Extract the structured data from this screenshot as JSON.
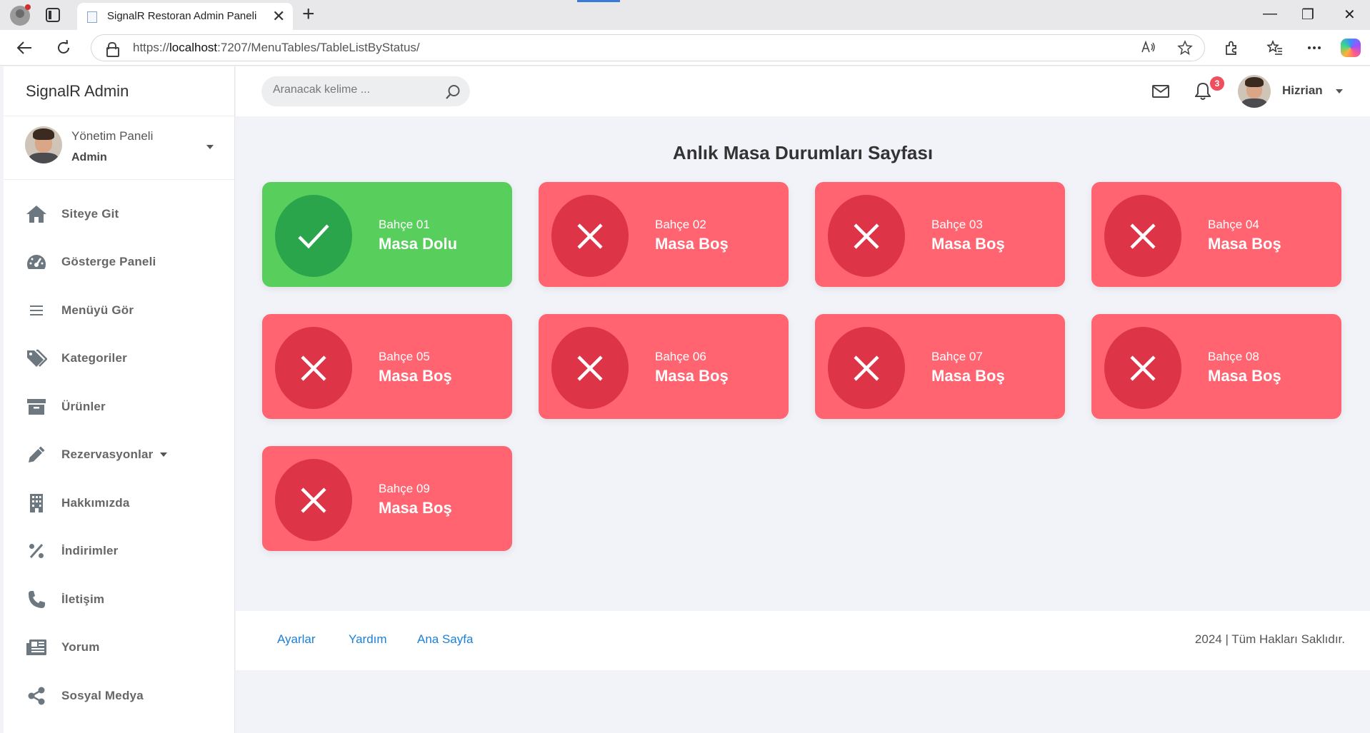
{
  "browser": {
    "tab_title": "SignalR Restoran Admin Paneli",
    "tab_close": "✕",
    "new_tab": "+",
    "url_scheme": "https://",
    "url_host": "localhost",
    "url_rest": ":7207/MenuTables/TableListByStatus/",
    "window_controls": [
      "—",
      "❐",
      "✕"
    ]
  },
  "sidebar": {
    "brand": "SignalR Admin",
    "user_title": "Yönetim Paneli",
    "user_role": "Admin",
    "items": [
      {
        "label": "Siteye Git",
        "icon": "home-icon"
      },
      {
        "label": "Gösterge Paneli",
        "icon": "dashboard-icon"
      },
      {
        "label": "Menüyü Gör",
        "icon": "menu-lines-icon"
      },
      {
        "label": "Kategoriler",
        "icon": "tags-icon"
      },
      {
        "label": "Ürünler",
        "icon": "archive-box-icon"
      },
      {
        "label": "Rezervasyonlar",
        "icon": "pencil-icon",
        "has_submenu": true
      },
      {
        "label": "Hakkımızda",
        "icon": "building-icon"
      },
      {
        "label": "İndirimler",
        "icon": "percent-icon"
      },
      {
        "label": "İletişim",
        "icon": "phone-icon"
      },
      {
        "label": "Yorum",
        "icon": "newspaper-icon"
      },
      {
        "label": "Sosyal Medya",
        "icon": "share-icon"
      }
    ]
  },
  "topbar": {
    "search_placeholder": "Aranacak kelime ...",
    "notification_count": "3",
    "username": "Hizrian"
  },
  "page": {
    "title": "Anlık Masa Durumları Sayfası"
  },
  "tables": [
    {
      "name": "Bahçe 01",
      "status": "Masa Dolu",
      "occupied": true
    },
    {
      "name": "Bahçe 02",
      "status": "Masa Boş",
      "occupied": false
    },
    {
      "name": "Bahçe 03",
      "status": "Masa Boş",
      "occupied": false
    },
    {
      "name": "Bahçe 04",
      "status": "Masa Boş",
      "occupied": false
    },
    {
      "name": "Bahçe 05",
      "status": "Masa Boş",
      "occupied": false
    },
    {
      "name": "Bahçe 06",
      "status": "Masa Boş",
      "occupied": false
    },
    {
      "name": "Bahçe 07",
      "status": "Masa Boş",
      "occupied": false
    },
    {
      "name": "Bahçe 08",
      "status": "Masa Boş",
      "occupied": false
    },
    {
      "name": "Bahçe 09",
      "status": "Masa Boş",
      "occupied": false
    }
  ],
  "colors": {
    "occupied": "#58cf5d",
    "occupied_circle": "#2aa54b",
    "empty": "#ff6470",
    "empty_circle": "#de3448",
    "link": "#1c7fd8"
  },
  "footer": {
    "links": [
      "Ayarlar",
      "Yardım",
      "Ana Sayfa"
    ],
    "copyright": "2024 | Tüm Hakları Saklıdır."
  }
}
